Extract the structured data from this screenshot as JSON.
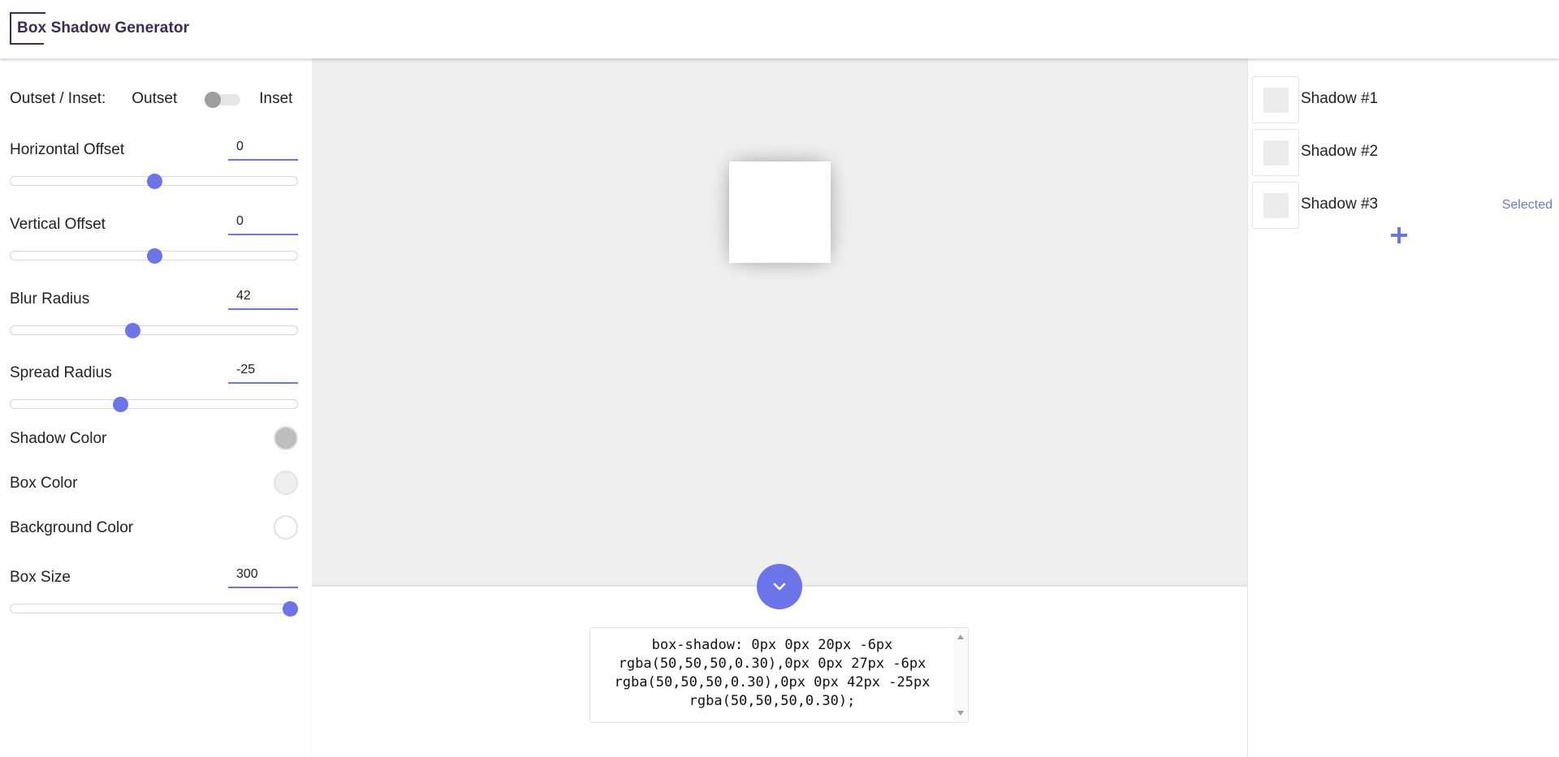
{
  "app": {
    "title": "Box Shadow Generator"
  },
  "controls": {
    "toggle": {
      "label": "Outset / Inset:",
      "left_option": "Outset",
      "right_option": "Inset",
      "state": "Outset"
    },
    "horizontal_offset": {
      "label": "Horizontal Offset",
      "value": "0",
      "slider_fraction": 0.5
    },
    "vertical_offset": {
      "label": "Vertical Offset",
      "value": "0",
      "slider_fraction": 0.5
    },
    "blur_radius": {
      "label": "Blur Radius",
      "value": "42",
      "slider_fraction": 0.42
    },
    "spread_radius": {
      "label": "Spread Radius",
      "value": "-25",
      "slider_fraction": 0.375
    },
    "shadow_color": {
      "label": "Shadow Color",
      "color": "#bdbdbd"
    },
    "box_color": {
      "label": "Box Color",
      "color": "#efefef"
    },
    "background_color": {
      "label": "Background Color",
      "color": "#ffffff"
    },
    "box_size": {
      "label": "Box Size",
      "value": "300",
      "slider_fraction": 1.0
    }
  },
  "code": {
    "text": "box-shadow: 0px 0px 20px -6px rgba(50,50,50,0.30),0px 0px 27px -6px rgba(50,50,50,0.30),0px 0px 42px -25px rgba(50,50,50,0.30);"
  },
  "shadows": [
    {
      "name": "Shadow #1",
      "selected": false
    },
    {
      "name": "Shadow #2",
      "selected": false
    },
    {
      "name": "Shadow #3",
      "selected": true,
      "selected_label": "Selected"
    }
  ],
  "colors": {
    "accent": "#6b74e8",
    "brand": "#3a2d5c",
    "preview_bg": "#efefef"
  },
  "icons": {
    "collapse": "chevron-down-icon",
    "add": "plus-icon"
  }
}
